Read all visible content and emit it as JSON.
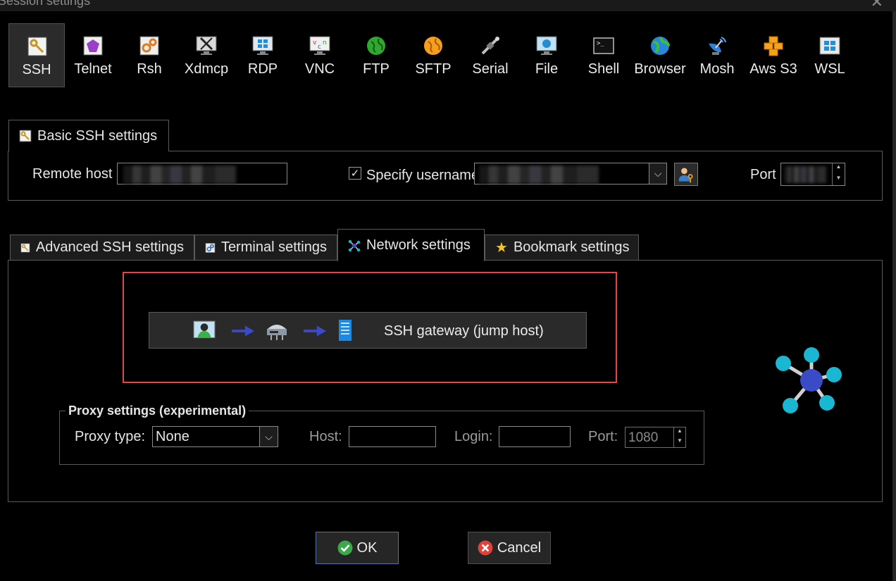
{
  "window": {
    "title": "Session settings"
  },
  "protocols": [
    {
      "label": "SSH",
      "icon": "key-icon",
      "active": true
    },
    {
      "label": "Telnet",
      "icon": "telnet-icon"
    },
    {
      "label": "Rsh",
      "icon": "gears-icon"
    },
    {
      "label": "Xdmcp",
      "icon": "x-monitor-icon"
    },
    {
      "label": "RDP",
      "icon": "windows-monitor-icon"
    },
    {
      "label": "VNC",
      "icon": "vnc-monitor-icon"
    },
    {
      "label": "FTP",
      "icon": "green-globe-icon"
    },
    {
      "label": "SFTP",
      "icon": "orange-globe-icon"
    },
    {
      "label": "Serial",
      "icon": "satellite-icon"
    },
    {
      "label": "File",
      "icon": "file-monitor-icon"
    },
    {
      "label": "Shell",
      "icon": "terminal-icon"
    },
    {
      "label": "Browser",
      "icon": "globe-icon"
    },
    {
      "label": "Mosh",
      "icon": "dish-icon"
    },
    {
      "label": "Aws S3",
      "icon": "cubes-icon"
    },
    {
      "label": "WSL",
      "icon": "wsl-windows-icon"
    }
  ],
  "basic": {
    "tab_label": "Basic SSH settings",
    "remote_host_label": "Remote host",
    "specify_username_label": "Specify username",
    "specify_username_checked": true,
    "port_label": "Port"
  },
  "tabs": [
    {
      "label": "Advanced SSH settings",
      "icon": "key-icon"
    },
    {
      "label": "Terminal settings",
      "icon": "gears-icon"
    },
    {
      "label": "Network settings",
      "icon": "network-icon",
      "active": true
    },
    {
      "label": "Bookmark settings",
      "icon": "star-icon"
    }
  ],
  "network": {
    "gateway_button_label": "SSH gateway (jump host)",
    "proxy": {
      "group_label": "Proxy settings (experimental)",
      "type_label": "Proxy type:",
      "type_value": "None",
      "host_label": "Host:",
      "host_value": "",
      "login_label": "Login:",
      "login_value": "",
      "port_label": "Port:",
      "port_value": "1080"
    }
  },
  "buttons": {
    "ok_label": "OK",
    "cancel_label": "Cancel"
  },
  "colors": {
    "highlight_box": "#e04848",
    "ok_border": "#5b6fa8",
    "accent_cyan": "#19b7d1",
    "hub_blue": "#3b4bc8"
  }
}
